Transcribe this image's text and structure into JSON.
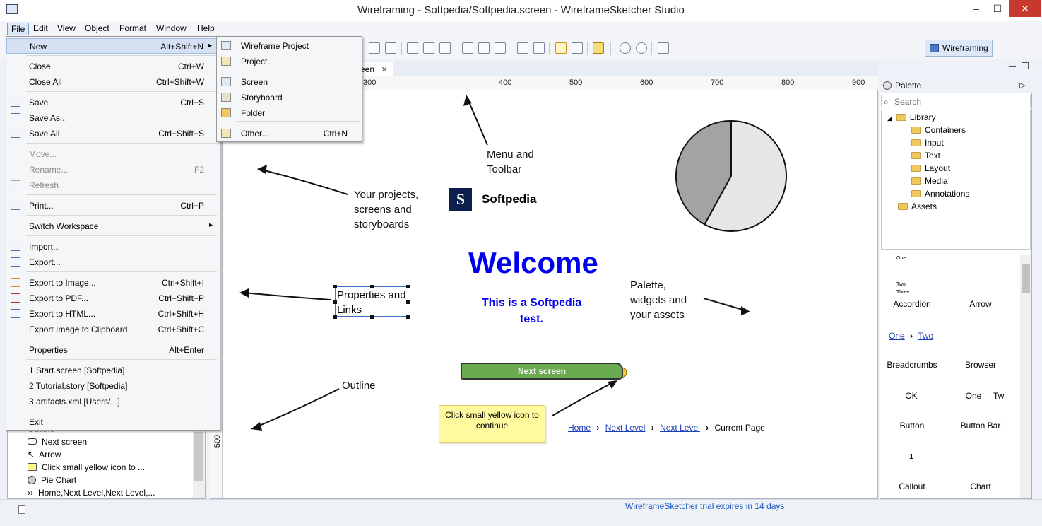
{
  "window": {
    "title": "Wireframing - Softpedia/Softpedia.screen - WireframeSketcher Studio",
    "controls": [
      "–",
      "☐",
      "✕"
    ]
  },
  "menubar": [
    "File",
    "Edit",
    "View",
    "Object",
    "Format",
    "Window",
    "Help"
  ],
  "perspective_label": "Wireframing",
  "editor": {
    "tab_label": "een",
    "ruler_top": [
      "300",
      "400",
      "500",
      "600",
      "700",
      "800",
      "900"
    ],
    "ruler_left": "500"
  },
  "file_menu": [
    {
      "label": "New",
      "shortcut": "Alt+Shift+N",
      "submenu": true,
      "highlight": true
    },
    {
      "label": "Close",
      "shortcut": "Ctrl+W"
    },
    {
      "label": "Close All",
      "shortcut": "Ctrl+Shift+W"
    },
    {
      "label": "Save",
      "shortcut": "Ctrl+S"
    },
    {
      "label": "Save As...",
      "shortcut": ""
    },
    {
      "label": "Save All",
      "shortcut": "Ctrl+Shift+S"
    },
    {
      "label": "Move...",
      "shortcut": "",
      "disabled": true
    },
    {
      "label": "Rename...",
      "shortcut": "F2",
      "disabled": true
    },
    {
      "label": "Refresh",
      "shortcut": "",
      "disabled": true
    },
    {
      "label": "Print...",
      "shortcut": "Ctrl+P"
    },
    {
      "label": "Switch Workspace",
      "shortcut": "",
      "submenu": true
    },
    {
      "label": "Import...",
      "shortcut": ""
    },
    {
      "label": "Export...",
      "shortcut": ""
    },
    {
      "label": "Export to Image...",
      "shortcut": "Ctrl+Shift+I"
    },
    {
      "label": "Export to PDF...",
      "shortcut": "Ctrl+Shift+P"
    },
    {
      "label": "Export to HTML...",
      "shortcut": "Ctrl+Shift+H"
    },
    {
      "label": "Export Image to Clipboard",
      "shortcut": "Ctrl+Shift+C"
    },
    {
      "label": "Properties",
      "shortcut": "Alt+Enter"
    },
    {
      "label": "1 Start.screen  [Softpedia]",
      "shortcut": ""
    },
    {
      "label": "2 Tutorial.story  [Softpedia]",
      "shortcut": ""
    },
    {
      "label": "3 artifacts.xml  [Users/...]",
      "shortcut": ""
    },
    {
      "label": "Exit",
      "shortcut": ""
    }
  ],
  "new_submenu": [
    {
      "label": "Wireframe Project",
      "shortcut": ""
    },
    {
      "label": "Project...",
      "shortcut": ""
    },
    {
      "label": "Screen",
      "shortcut": ""
    },
    {
      "label": "Storyboard",
      "shortcut": ""
    },
    {
      "label": "Folder",
      "shortcut": ""
    },
    {
      "label": "Other...",
      "shortcut": "Ctrl+N"
    }
  ],
  "canvas": {
    "annotations": {
      "menu_toolbar": [
        "Menu and",
        "Toolbar"
      ],
      "projects": [
        "Your projects,",
        "screens and",
        "storyboards"
      ],
      "properties": [
        "Properties and",
        "Links"
      ],
      "palette": [
        "Palette,",
        "widgets and",
        "your assets"
      ],
      "outline": "Outline"
    },
    "logo_letter": "S",
    "brand": "Softpedia",
    "welcome": "Welcome",
    "subtitle": "This is a Softpedia test.",
    "next_button": "Next screen",
    "sticky_note": "Click small yellow icon to continue",
    "breadcrumb": [
      "Home",
      "Next Level",
      "Next Level",
      "Current Page"
    ],
    "pie_chart": {
      "slices": [
        0.42,
        0.58
      ],
      "colors": [
        "#a3a3a3",
        "#e6e6e6"
      ]
    }
  },
  "palette": {
    "title": "Palette",
    "search_placeholder": "Search",
    "tree": [
      "Library",
      "Containers",
      "Input",
      "Text",
      "Layout",
      "Media",
      "Annotations",
      "Assets"
    ],
    "widgets": [
      "Accordion",
      "Arrow",
      "Breadcrumbs",
      "Browser",
      "Button",
      "Button Bar",
      "Callout",
      "Chart"
    ],
    "accordion_rows": [
      "One",
      "Two",
      "Three"
    ],
    "breadcrumb_sample": [
      "One",
      "Two"
    ],
    "button_sample": "OK",
    "buttonbar_sample": [
      "One",
      "Tw"
    ],
    "callout_sample": "1"
  },
  "outline": [
    {
      "icon": "ok",
      "label": "Next screen"
    },
    {
      "icon": "arrow",
      "label": "Arrow"
    },
    {
      "icon": "note",
      "label": "Click small yellow icon to ..."
    },
    {
      "icon": "pie",
      "label": "Pie Chart"
    },
    {
      "icon": "crumb",
      "label": "Home,Next Level,Next Level,..."
    }
  ],
  "outline_partial": "Outline",
  "status": {
    "trial": "WireframeSketcher trial expires in 14 days"
  }
}
